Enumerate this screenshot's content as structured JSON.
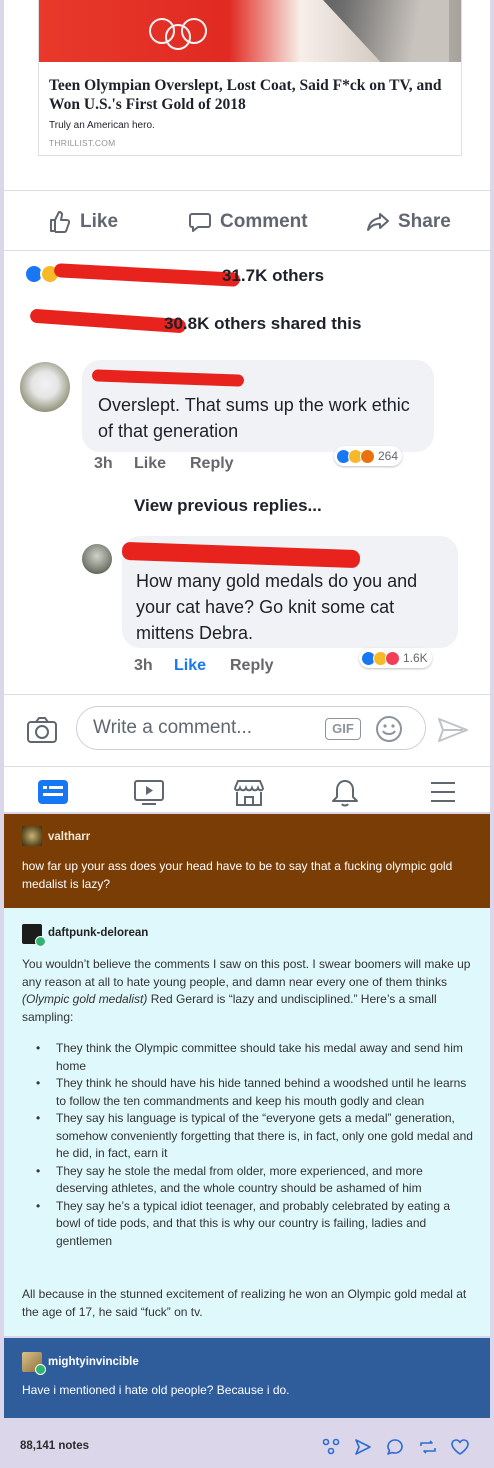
{
  "link": {
    "title": "Teen Olympian Overslept, Lost Coat, Said F*ck on TV, and Won U.S.'s First Gold of 2018",
    "subtitle": "Truly an American hero.",
    "source": "THRILLIST.COM"
  },
  "actions": {
    "like": "Like",
    "comment": "Comment",
    "share": "Share"
  },
  "reactions_summary": {
    "text": "31.7K others"
  },
  "shares_summary": {
    "text": "30.8K others shared this"
  },
  "comments": [
    {
      "text": "Overslept.  That sums up the work ethic of that generation",
      "time": "3h",
      "like": "Like",
      "reply": "Reply",
      "reaction_count": "264"
    },
    {
      "text": "How many gold medals do you and your cat have? Go knit some cat mittens Debra.",
      "time": "3h",
      "like": "Like",
      "reply": "Reply",
      "reaction_count": "1.6K"
    }
  ],
  "view_previous": "View previous replies...",
  "write_comment": {
    "placeholder": "Write a comment...",
    "gif": "GIF"
  },
  "tumblr_posts": {
    "p1": {
      "username": "valtharr",
      "text": "how far up your ass does your head have to be to say that a fucking olympic gold medalist is lazy?",
      "bg": "#7a3d06"
    },
    "p2": {
      "username": "daftpunk-delorean",
      "intro_a": "You wouldn’t believe the comments I saw on this post. I swear boomers will make up any reason at all to hate young people, and damn near every one of them thinks ",
      "intro_em": "(Olympic gold medalist)",
      "intro_b": " Red Gerard is “lazy and undisciplined.” Here’s a small sampling:",
      "bullets": [
        "They think the Olympic committee should take his medal away and send him home",
        "They think he should have his hide tanned behind a woodshed until he learns to follow the ten commandments and keep his mouth godly and clean",
        "They say his language is typical of the “everyone gets a medal” generation, somehow conveniently forgetting that there is, in fact, only one gold medal and he did, in fact, earn it",
        "They say he stole the medal from older, more experienced, and more deserving athletes, and the whole country should be ashamed of him",
        "They say he’s a typical idiot teenager, and probably celebrated by eating a bowl of tide pods, and that this is why our country is failing, ladies and gentlemen"
      ],
      "outro": "All because in the stunned excitement of realizing he won an Olympic gold medal at the age of 17, he said “fuck” on tv.",
      "bg": "#dff8fb"
    },
    "p3": {
      "username": "mightyinvincible",
      "text": "Have i mentioned i hate old people? Because i do.",
      "bg": "#2f5d9b"
    }
  },
  "notes": {
    "count": "88,141 notes"
  },
  "colors": {
    "fb_blue": "#1877f2",
    "redact_red": "#e8221d",
    "tumblr_bg": "#dcd6ea"
  }
}
